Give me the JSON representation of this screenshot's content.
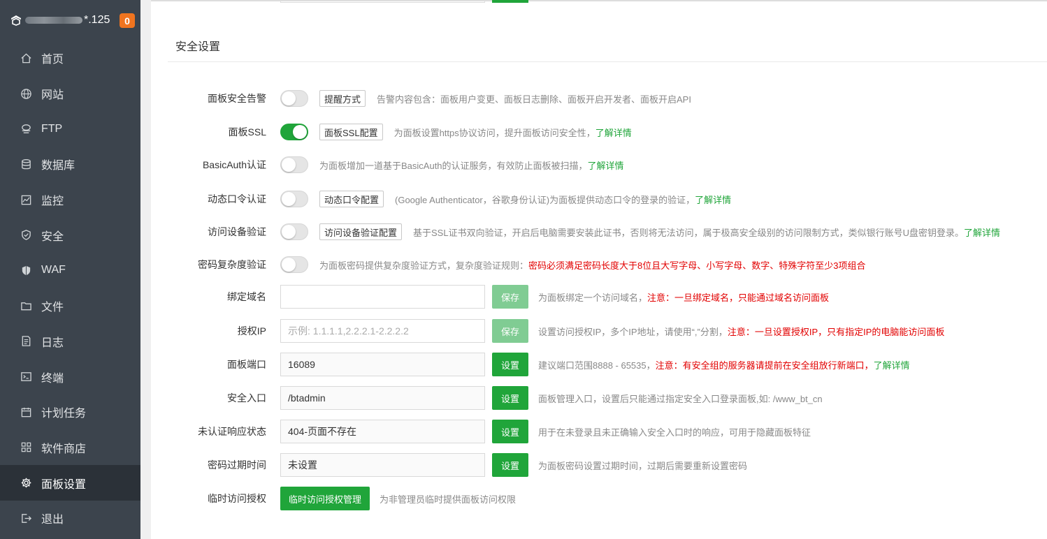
{
  "sidebar": {
    "server_ip_suffix": "*.125",
    "badge_count": "0",
    "items": [
      {
        "label": "首页",
        "icon": "home-icon"
      },
      {
        "label": "网站",
        "icon": "globe-icon"
      },
      {
        "label": "FTP",
        "icon": "ftp-icon"
      },
      {
        "label": "数据库",
        "icon": "database-icon"
      },
      {
        "label": "监控",
        "icon": "monitor-icon"
      },
      {
        "label": "安全",
        "icon": "shield-icon"
      },
      {
        "label": "WAF",
        "icon": "waf-shield-icon"
      },
      {
        "label": "文件",
        "icon": "folder-icon"
      },
      {
        "label": "日志",
        "icon": "log-icon"
      },
      {
        "label": "终端",
        "icon": "terminal-icon"
      },
      {
        "label": "计划任务",
        "icon": "calendar-icon"
      },
      {
        "label": "软件商店",
        "icon": "grid-icon"
      },
      {
        "label": "面板设置",
        "icon": "gear-icon",
        "active": true
      },
      {
        "label": "退出",
        "icon": "logout-icon"
      }
    ]
  },
  "section": {
    "title": "安全设置"
  },
  "settings": {
    "alert": {
      "label": "面板安全告警",
      "enabled": false,
      "button": "提醒方式",
      "desc": "告警内容包含：面板用户变更、面板日志删除、面板开启开发者、面板开启API"
    },
    "ssl": {
      "label": "面板SSL",
      "enabled": true,
      "button": "面板SSL配置",
      "desc": "为面板设置https协议访问，提升面板访问安全性，",
      "link": "了解详情"
    },
    "basicauth": {
      "label": "BasicAuth认证",
      "enabled": false,
      "desc": "为面板增加一道基于BasicAuth的认证服务，有效防止面板被扫描，",
      "link": "了解详情"
    },
    "totp": {
      "label": "动态口令认证",
      "enabled": false,
      "button": "动态口令配置",
      "desc": "(Google Authenticator，谷歌身份认证)为面板提供动态口令的登录的验证，",
      "link": "了解详情"
    },
    "device": {
      "label": "访问设备验证",
      "enabled": false,
      "button": "访问设备验证配置",
      "desc": "基于SSL证书双向验证，开启后电脑需要安装此证书，否则将无法访问，属于极高安全级别的访问限制方式，类似银行账号U盘密钥登录。",
      "link": "了解详情"
    },
    "pwd_complexity": {
      "label": "密码复杂度验证",
      "enabled": false,
      "desc": "为面板密码提供复杂度验证方式，复杂度验证规则：",
      "warn": "密码必须满足密码长度大于8位且大写字母、小写字母、数字、特殊字符至少3项组合"
    },
    "domain": {
      "label": "绑定域名",
      "value": "",
      "placeholder": "",
      "button": "保存",
      "desc": "为面板绑定一个访问域名，",
      "warn": "注意：一旦绑定域名，只能通过域名访问面板"
    },
    "auth_ip": {
      "label": "授权IP",
      "value": "",
      "placeholder": "示例: 1.1.1.1,2.2.2.1-2.2.2.2",
      "button": "保存",
      "desc": "设置访问授权IP，多个IP地址，请使用“,”分割，",
      "warn": "注意：一旦设置授权IP，只有指定IP的电脑能访问面板"
    },
    "port": {
      "label": "面板端口",
      "value": "16089",
      "button": "设置",
      "desc": "建议端口范围8888 - 65535，",
      "warn": "注意：有安全组的服务器请提前在安全组放行新端口，",
      "link": "了解详情"
    },
    "entry": {
      "label": "安全入口",
      "value": "/btadmin",
      "button": "设置",
      "desc": "面板管理入口，设置后只能通过指定安全入口登录面板,如: /www_bt_cn"
    },
    "unauth_status": {
      "label": "未认证响应状态",
      "value": "404-页面不存在",
      "button": "设置",
      "desc": "用于在未登录且未正确输入安全入口时的响应，可用于隐藏面板特征"
    },
    "pwd_expire": {
      "label": "密码过期时间",
      "value": "未设置",
      "button": "设置",
      "desc": "为面板密码设置过期时间，过期后需要重新设置密码"
    },
    "temp_access": {
      "label": "临时访问授权",
      "button": "临时访问授权管理",
      "desc": "为非管理员临时提供面板访问权限"
    }
  }
}
